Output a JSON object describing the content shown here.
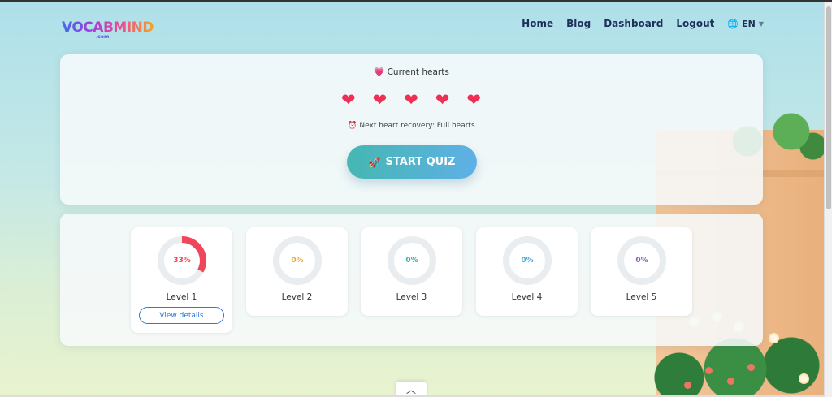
{
  "header": {
    "logo_text": "VOCABMIND",
    "logo_sub": ".com",
    "nav": [
      {
        "label": "Home"
      },
      {
        "label": "Blog"
      },
      {
        "label": "Dashboard"
      },
      {
        "label": "Logout"
      }
    ],
    "language": "EN"
  },
  "hearts": {
    "title": "Current hearts",
    "count": 5,
    "recovery": "Next heart recovery: Full hearts",
    "start_label": "START QUIZ"
  },
  "levels": [
    {
      "label": "Level 1",
      "percent_text": "33%",
      "percent": 33,
      "color": "#f0455a",
      "details_label": "View details"
    },
    {
      "label": "Level 2",
      "percent_text": "0%",
      "percent": 0,
      "color": "#e8a93a"
    },
    {
      "label": "Level 3",
      "percent_text": "0%",
      "percent": 0,
      "color": "#3cb3a4"
    },
    {
      "label": "Level 4",
      "percent_text": "0%",
      "percent": 0,
      "color": "#4aa8e0"
    },
    {
      "label": "Level 5",
      "percent_text": "0%",
      "percent": 0,
      "color": "#8b5fc4"
    }
  ],
  "colors": {
    "accent": "#2f78d6",
    "heart": "#ee3055"
  }
}
